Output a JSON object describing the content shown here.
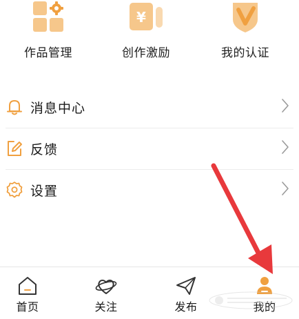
{
  "grid": {
    "items": [
      {
        "label": "作品管理",
        "icon": "works-grid-icon"
      },
      {
        "label": "创作激励",
        "icon": "yuan-coin-icon"
      },
      {
        "label": "我的认证",
        "icon": "verified-v-shield-icon"
      }
    ]
  },
  "menu": {
    "items": [
      {
        "label": "消息中心",
        "icon": "bell-icon"
      },
      {
        "label": "反馈",
        "icon": "edit-icon"
      },
      {
        "label": "设置",
        "icon": "gear-icon"
      }
    ]
  },
  "tabbar": {
    "items": [
      {
        "label": "首页",
        "icon": "home-icon"
      },
      {
        "label": "关注",
        "icon": "heart-orbit-icon"
      },
      {
        "label": "发布",
        "icon": "paper-plane-icon"
      },
      {
        "label": "我的",
        "icon": "user-icon",
        "active": true
      }
    ]
  },
  "colors": {
    "accent": "#f0a040",
    "accent_light": "#f6c78b",
    "annotation_arrow": "#e8393c",
    "text": "#1a1a1a",
    "chevron": "#9a9a9a"
  }
}
